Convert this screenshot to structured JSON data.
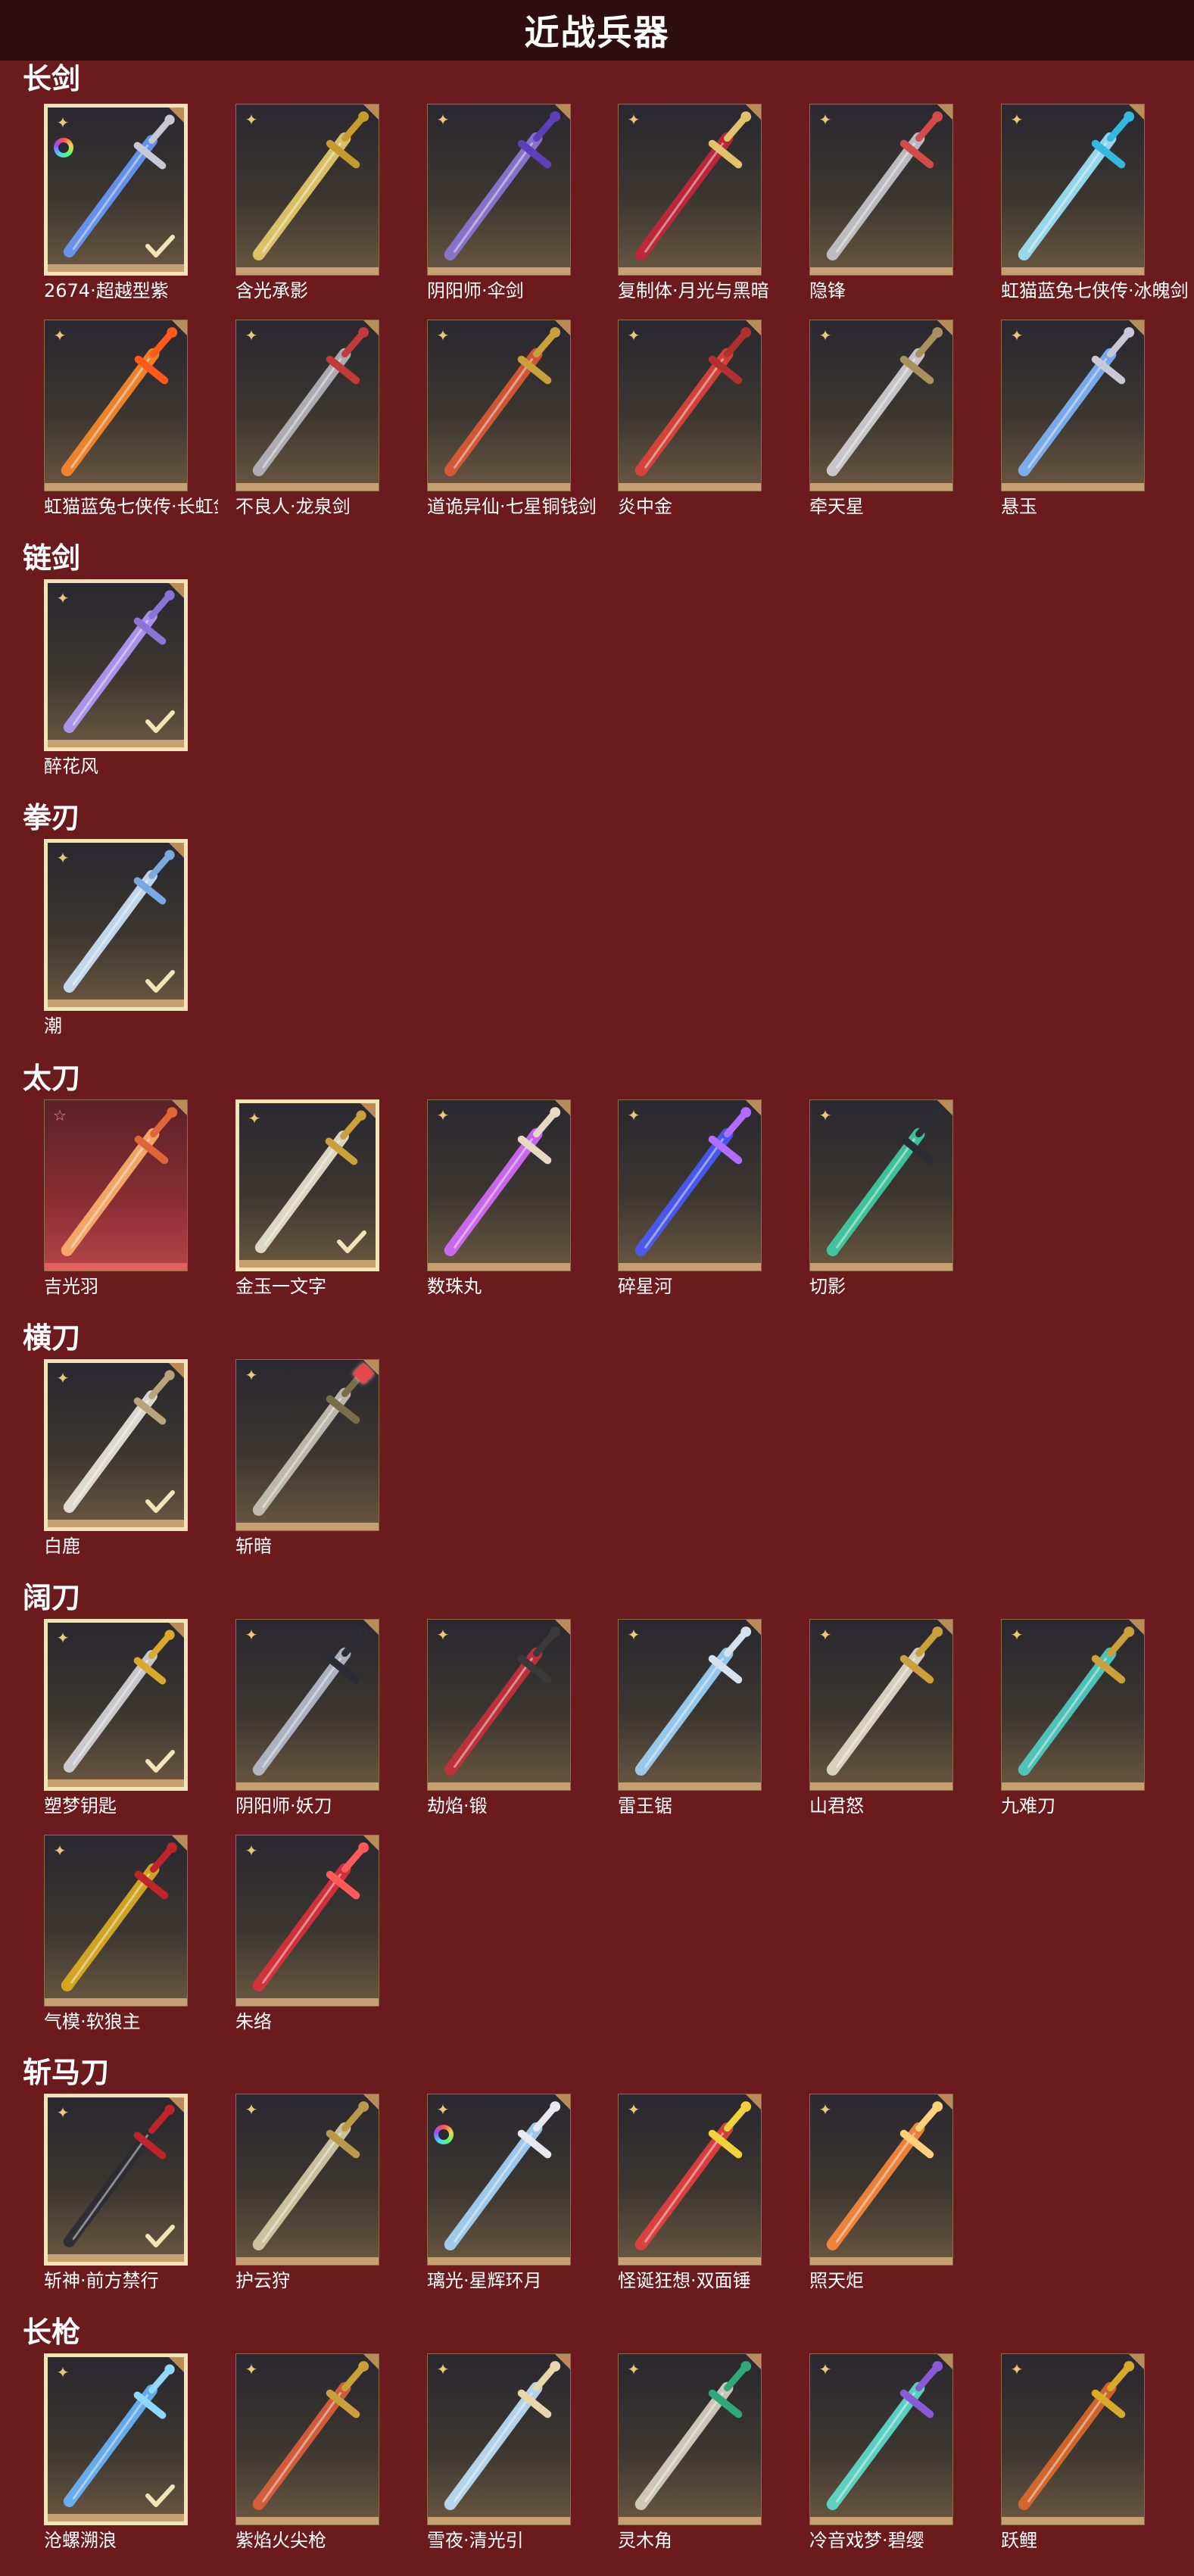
{
  "header": {
    "title": "近战兵器"
  },
  "sections": [
    {
      "title": "长剑",
      "items": [
        {
          "name": "2674·超越型紫",
          "blade": "#6a9bff",
          "hilt": "#c9c9d6",
          "selected": true,
          "rainbow": true
        },
        {
          "name": "含光承影",
          "blade": "#e8cf6a",
          "hilt": "#c79a2e"
        },
        {
          "name": "阴阳师·伞剑",
          "blade": "#8d79d9",
          "hilt": "#5d3fb8"
        },
        {
          "name": "复制体·月光与黑暗",
          "blade": "#c7263a",
          "hilt": "#e0c36a"
        },
        {
          "name": "隐锋",
          "blade": "#c9c9d0",
          "hilt": "#d24a4a"
        },
        {
          "name": "虹猫蓝兔七侠传·冰魄剑",
          "blade": "#9fe8ff",
          "hilt": "#33b8e0"
        }
      ]
    },
    {
      "items": [
        {
          "name": "虹猫蓝兔七侠传·长虹剑",
          "blade": "#ff8a2a",
          "hilt": "#ff5a1a"
        },
        {
          "name": "不良人·龙泉剑",
          "blade": "#b8b8c0",
          "hilt": "#c23a3a"
        },
        {
          "name": "道诡异仙·七星铜钱剑",
          "blade": "#e05a36",
          "hilt": "#c9a03a"
        },
        {
          "name": "炎中金",
          "blade": "#e2433a",
          "hilt": "#b03030"
        },
        {
          "name": "牵天星",
          "blade": "#d4d4d8",
          "hilt": "#a8915e"
        },
        {
          "name": "悬玉",
          "blade": "#7fb7ff",
          "hilt": "#c9c9d6"
        }
      ]
    },
    {
      "title": "链剑",
      "items": [
        {
          "name": "醉花风",
          "blade": "#b49cff",
          "hilt": "#8a74d6",
          "selected": true
        }
      ]
    },
    {
      "title": "拳刃",
      "items": [
        {
          "name": "潮",
          "blade": "#cfe7ff",
          "hilt": "#7aa9e0",
          "selected": true
        }
      ]
    },
    {
      "title": "太刀",
      "items": [
        {
          "name": "吉光羽",
          "blade": "#ffb36b",
          "hilt": "#e0663a",
          "red": true,
          "star": true
        },
        {
          "name": "金玉一文字",
          "blade": "#ece6d2",
          "hilt": "#c9a03a",
          "selected": true
        },
        {
          "name": "数珠丸",
          "blade": "#d86cff",
          "hilt": "#e6d9c2"
        },
        {
          "name": "碎星河",
          "blade": "#4a5bff",
          "hilt": "#b26cff"
        },
        {
          "name": "切影",
          "blade": "#3fd1a6",
          "hilt": "#2c2c34"
        }
      ]
    },
    {
      "title": "横刀",
      "items": [
        {
          "name": "白鹿",
          "blade": "#eeeae0",
          "hilt": "#b8a47a",
          "selected": true
        },
        {
          "name": "斩暗",
          "blade": "#c9c6b8",
          "hilt": "#7a6d4a",
          "gem": true
        }
      ]
    },
    {
      "title": "阔刀",
      "items": [
        {
          "name": "塑梦钥匙",
          "blade": "#d8d8dc",
          "hilt": "#d9a92a",
          "selected": true
        },
        {
          "name": "阴阳师·妖刀",
          "blade": "#b8bfd0",
          "hilt": "#2c2c34"
        },
        {
          "name": "劫焰·锻",
          "blade": "#c9303a",
          "hilt": "#3a3a3a"
        },
        {
          "name": "雷王锯",
          "blade": "#9fd7ff",
          "hilt": "#d4e2f0"
        },
        {
          "name": "山君怒",
          "blade": "#e6e0cc",
          "hilt": "#c9a03a"
        },
        {
          "name": "九难刀",
          "blade": "#4fd1c5",
          "hilt": "#c9a03a"
        }
      ]
    },
    {
      "items": [
        {
          "name": "气模·软狼主",
          "blade": "#e0b020",
          "hilt": "#c0242a"
        },
        {
          "name": "朱络",
          "blade": "#e0303a",
          "hilt": "#ff5a5a"
        }
      ]
    },
    {
      "title": "斩马刀",
      "items": [
        {
          "name": "斩神·前方禁行",
          "blade": "#2c2c34",
          "hilt": "#c0242a",
          "selected": true
        },
        {
          "name": "护云狩",
          "blade": "#d9cfa8",
          "hilt": "#b89a4a"
        },
        {
          "name": "璃光·星辉环月",
          "blade": "#a8d8ff",
          "hilt": "#e8e8f0",
          "rainbow": true
        },
        {
          "name": "怪诞狂想·双面锤",
          "blade": "#e84040",
          "hilt": "#f2d23a"
        },
        {
          "name": "照天炬",
          "blade": "#ff8a3a",
          "hilt": "#ffd07a"
        }
      ]
    },
    {
      "title": "长枪",
      "items": [
        {
          "name": "沧螺溯浪",
          "blade": "#6ab8ff",
          "hilt": "#8fd8ff",
          "selected": true
        },
        {
          "name": "紫焰火尖枪",
          "blade": "#e0603a",
          "hilt": "#c9a03a"
        },
        {
          "name": "雪夜·清光引",
          "blade": "#bfe4ff",
          "hilt": "#e8d7a8"
        },
        {
          "name": "灵木角",
          "blade": "#dcd6c6",
          "hilt": "#2fa87a"
        },
        {
          "name": "冷音戏梦·碧缨",
          "blade": "#5fe0d0",
          "hilt": "#8a5ad6"
        },
        {
          "name": "跃鲤",
          "blade": "#e06a2a",
          "hilt": "#d9a92a"
        }
      ]
    }
  ]
}
